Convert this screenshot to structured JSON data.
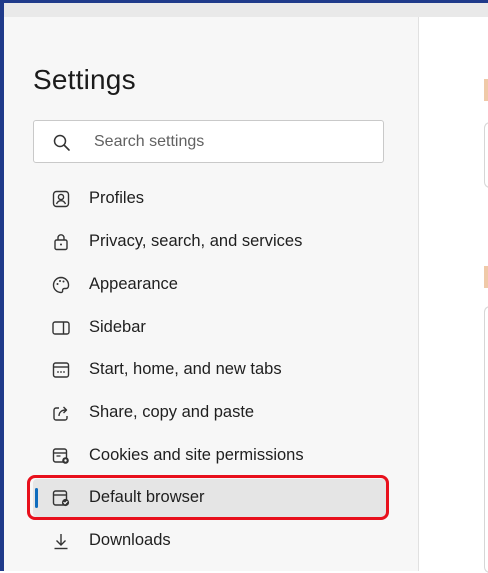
{
  "settings": {
    "title": "Settings",
    "search": {
      "placeholder": "Search settings"
    },
    "nav": [
      {
        "label": "Profiles",
        "icon": "profile-icon"
      },
      {
        "label": "Privacy, search, and services",
        "icon": "lock-icon"
      },
      {
        "label": "Appearance",
        "icon": "palette-icon"
      },
      {
        "label": "Sidebar",
        "icon": "sidebar-icon"
      },
      {
        "label": "Start, home, and new tabs",
        "icon": "start-home-icon"
      },
      {
        "label": "Share, copy and paste",
        "icon": "share-icon"
      },
      {
        "label": "Cookies and site permissions",
        "icon": "cookies-permissions-icon"
      },
      {
        "label": "Default browser",
        "icon": "default-browser-icon",
        "selected": true
      },
      {
        "label": "Downloads",
        "icon": "download-icon"
      }
    ]
  },
  "colors": {
    "accent": "#0f6cbd",
    "highlight": "#e8101c",
    "frame": "#1f3a8a"
  }
}
